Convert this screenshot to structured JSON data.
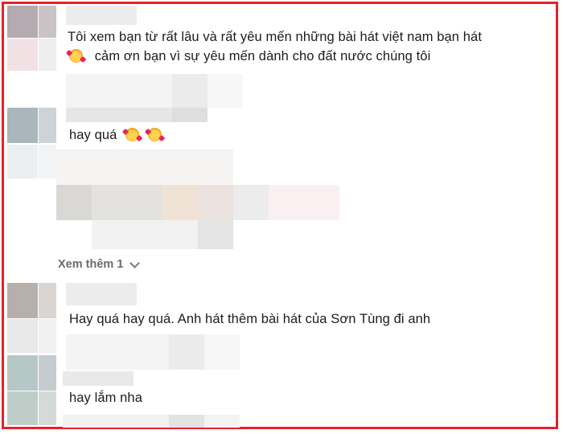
{
  "comments": [
    {
      "text": "Tôi xem bạn từ rất lâu và rất yêu mến những bài hát việt nam bạn hát",
      "text_line2": "cảm ơn bạn vì sự yêu mến dành cho đất nước chúng tôi"
    },
    {
      "text": "hay quá"
    },
    {
      "text": "Hay quá hay quá. Anh hát thêm bài hát của Sơn Tùng đi anh"
    },
    {
      "text": "hay lắm nha"
    }
  ],
  "see_more": {
    "label": "Xem thêm 1"
  },
  "icons": {
    "emoji": "smiling-face-with-hearts-icon",
    "chevron": "chevron-down-icon"
  },
  "colors": {
    "frame": "#e8202a"
  }
}
